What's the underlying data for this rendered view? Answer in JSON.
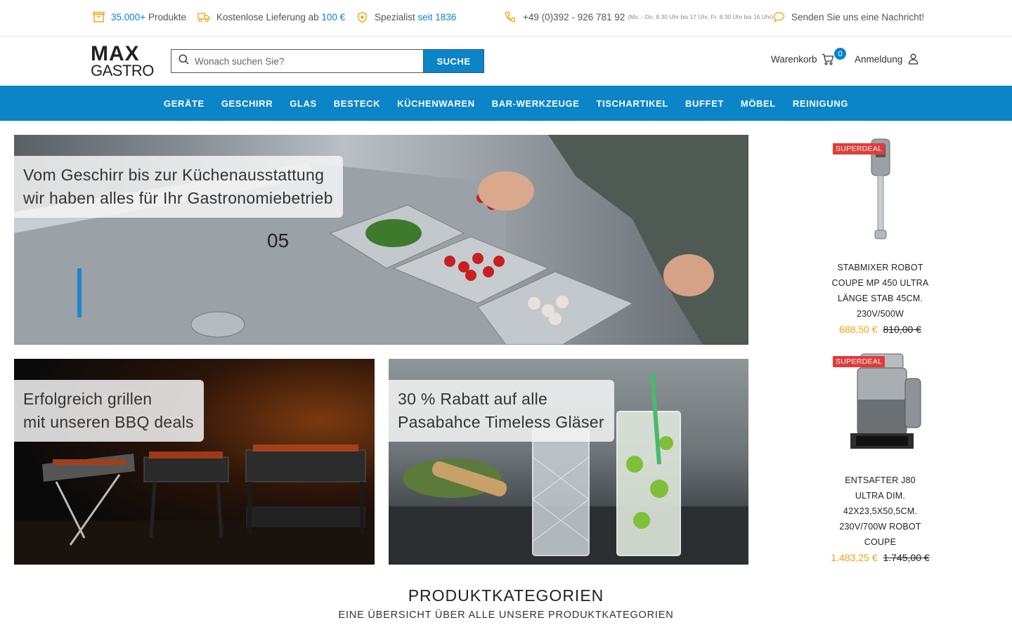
{
  "topbar": {
    "products_count": "35.000+",
    "products_label": "Produkte",
    "delivery_label": "Kostenlose Lieferung ab",
    "delivery_amount": "100 €",
    "specialist_label": "Spezialist",
    "specialist_since": "seit 1836",
    "phone": "+49 (0)392 - 926 781 92",
    "phone_hours": "(Mo. - Do. 8.30 Uhr bis 17 Uhr, Fr. 8.30 Uhr bis 16 Uhr)",
    "message_link": "Senden Sie uns eine Nachricht!"
  },
  "header": {
    "logo_line1": "MAX",
    "logo_line2": "GASTRO",
    "search_placeholder": "Wonach suchen Sie?",
    "search_button": "SUCHE",
    "cart_label": "Warenkorb",
    "cart_count": "0",
    "login_label": "Anmeldung"
  },
  "nav": {
    "items": [
      "GERÄTE",
      "GESCHIRR",
      "GLAS",
      "BESTECK",
      "KÜCHENWAREN",
      "BAR-WERKZEUGE",
      "TISCHARTIKEL",
      "BUFFET",
      "MÖBEL",
      "REINIGUNG"
    ]
  },
  "banners": {
    "main": {
      "line1": "Vom Geschirr bis zur Küchenausstattung",
      "line2": "wir haben alles für Ihr Gastronomiebetrieb"
    },
    "bbq": {
      "line1": "Erfolgreich grillen",
      "line2": "mit unseren BBQ deals"
    },
    "glass": {
      "line1": "30 % Rabatt auf alle",
      "line2": "Pasabahce Timeless Gläser"
    }
  },
  "products": [
    {
      "badge": "SUPERDEAL",
      "name": "STABMIXER ROBOT COUPE MP 450 ULTRA LÄNGE STAB 45CM. 230V/500W",
      "price": "688,50 €",
      "old_price": "810,00 €"
    },
    {
      "badge": "SUPERDEAL",
      "name": "ENTSAFTER J80 ULTRA DIM. 42X23,5X50,5CM. 230V/700W ROBOT COUPE",
      "price": "1.483,25 €",
      "old_price": "1.745,00 €"
    }
  ],
  "categories": {
    "title": "PRODUKTKATEGORIEN",
    "subtitle": "EINE ÜBERSICHT ÜBER ALLE UNSERE PRODUKTKATEGORIEN"
  },
  "colors": {
    "brand_blue": "#0b84c8",
    "deal_red": "#e23b3b",
    "price_orange": "#f0a316",
    "icon_orange": "#f0a316"
  },
  "icons": [
    "box-icon",
    "truck-icon",
    "badge-icon",
    "phone-icon",
    "chat-icon",
    "search-icon",
    "cart-icon",
    "user-icon"
  ]
}
